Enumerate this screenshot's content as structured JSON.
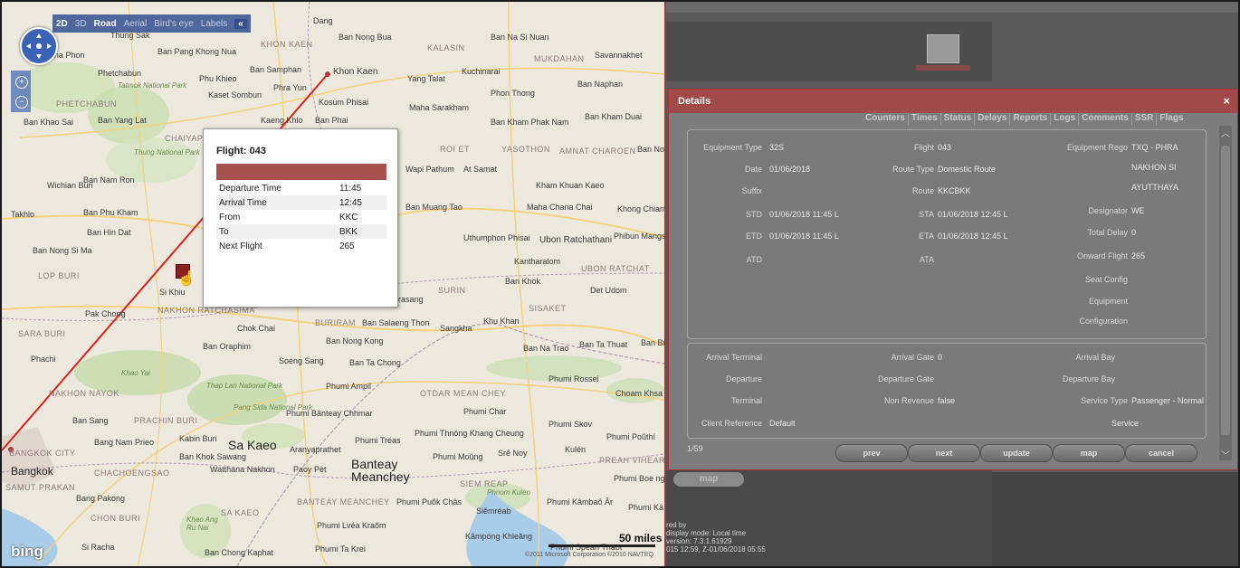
{
  "map": {
    "toolbar": {
      "mode2d": "2D",
      "mode3d": "3D",
      "road": "Road",
      "aerial": "Aerial",
      "birdseye": "Bird's eye",
      "labels": "Labels",
      "collapse": "«"
    },
    "popup": {
      "title": "Flight: 043",
      "rows": [
        {
          "label": "Departure Time",
          "value": "11:45"
        },
        {
          "label": "Arrival Time",
          "value": "12:45"
        },
        {
          "label": "From",
          "value": "KKC"
        },
        {
          "label": "To",
          "value": "BKK"
        },
        {
          "label": "Next Flight",
          "value": "265"
        }
      ]
    },
    "labels": {
      "khon_kaen": "Khon Kaen",
      "khon_kaen_region": "KHON KAEN",
      "kalasin": "KALASIN",
      "mukdahan": "MUKDAHAN",
      "savannakhet": "Savannakhet",
      "ban_nong_bua": "Ban Nong Bua",
      "ban_na_si_nuan": "Ban Na Si Nuan",
      "kuchinarai": "Kuchinarai",
      "ban_naphan": "Ban Naphan",
      "phon_thong": "Phon Thong",
      "maha_sarakham": "Maha Sarakham",
      "kosum_phisai": "Kosum Phisai",
      "ban_phai": "Ban Phai",
      "kaeng_khlo": "Kaeng Khlo",
      "ban_kham_phak_nam": "Ban Kham Phak Nam",
      "ban_kham_duai": "Ban Kham Duai",
      "yang_talat": "Yang Talat",
      "ban_samphan": "Ban Samphan",
      "phu_khieo": "Phu Khieo",
      "phra_yun": "Phra Yun",
      "kaset_sombun": "Kaset Sombun",
      "ban_pang_khong_nua": "Ban Pang Khong Nua",
      "an_tha_phon": "an Tha Phon",
      "phetchabun": "Phetchabun",
      "phetchabun_region": "PHETCHABUN",
      "tatmok": "Tatmok National Park",
      "ban_khao_sai": "Ban Khao Sai",
      "ban_yang_lat": "Ban Yang Lat",
      "chaiyaphum_region": "CHAIYAPH",
      "thung": "Thung National Park",
      "ban_nam_ron": "Ban Nam Ron",
      "wichian_buri": "Wichian Buri",
      "takhlo": "Takhlo",
      "ban_phu_kham": "Ban Phu Kham",
      "ban_hin_dat": "Ban Hin Dat",
      "ban_nong_si_ma": "Ban Nong Si Ma",
      "lop_buri": "LOP BURI",
      "si_khiu": "Si Khiu",
      "pak_chong": "Pak Chong",
      "nakhon_ratchasima": "NAKHON RATCHASIMA",
      "saraburi": "SARA BURI",
      "chok_chai": "Chok Chai",
      "ban_oraphim": "Ban Oraphim",
      "buriram": "BURIRAM",
      "ban_salaeng_thon": "Ban Salaeng Thon",
      "sangkha": "Sangkha",
      "khu_khan": "Khu Khan",
      "sisaket": "SISAKET",
      "ban_nong_kong": "Ban Nong Kong",
      "roi_et": "ROI ET",
      "yasothon": "YASOTHON",
      "amnat": "AMNAT CHAROEN",
      "ban_no": "Ban No",
      "wapi_pathum": "Wapi Pathum",
      "at_samat": "At Samat",
      "kham_khuan_kaeo": "Kham Khuan Kaeo",
      "ban_muang_tao": "Ban Muang Tao",
      "maha_chana_chai": "Maha Chana Chai",
      "khong_chiam": "Khong Chiam",
      "uthumphon": "Uthumphon Phisai",
      "ubon": "Ubon Ratchathani",
      "phibun": "Phibun Mangsahan",
      "kantharalak": "Kantharalom",
      "ubon_region": "UBON RATCHAT",
      "ban_khok": "Ban Khok",
      "surin": "SURIN",
      "det_udom": "Det Udom",
      "prasang": "rasang",
      "ban_na_trao": "Ban Na Trao",
      "ban_ta_thuat": "Ban Ta Thuat",
      "ban_bu": "Ban Bu",
      "soeng_sang": "Soeng Sang",
      "ban_ta_chong": "Ban Ta Chong",
      "phachi": "Phachi",
      "khao_yai": "Khao Yai",
      "thap_lan": "Thap Lan National Park",
      "pang_sida": "Pang Sida National Park",
      "nakhon_nayok": "NAKHON NAYOK",
      "prachin_buri": "PRACHIN BURI",
      "ban_sang": "Ban Sang",
      "phumi_ampil": "Phumi Ampil",
      "otdar_mean_chey": "OTDAR MEAN CHEY",
      "phumi_rossei": "Phumi Rossei",
      "choam_khsant": "Choam Khsa",
      "phumi_banteay": "Phumi Bânteay Chhmar",
      "phumi_char": "Phumi Char",
      "phumi_skov": "Phumi Skov",
      "phumi_thnong": "Phumi Thnóng Khang Cheung",
      "phumi_treas": "Phumi Tréas",
      "phumi_pouthi": "Phumi Poŭthí",
      "kulen": "Kulén",
      "preah_vihear": "PREAH VIHEAR",
      "sre_noy": "Srê Noy",
      "phumi_moung": "Phumi Moŭng",
      "sa_kaeo": "Sa Kaeo",
      "aranyaprathet": "Aranyaprathet",
      "kabin_buri": "Kabin Buri",
      "bang_nam_prieo": "Bang Nam Prieo",
      "ban_khok_sawang": "Ban Khok Sawang",
      "watthana_nakhon": "Watthana Nakhon",
      "poipet": "Paoy Pèt",
      "banteay_meanchey": "Banteay Meanchey",
      "siem_reap": "SIEM REAP",
      "phnom_kulen": "Phnom Kulen",
      "phumi_boeng": "Phumi Boe ng",
      "bangkok": "Bangkok",
      "bangkok_city": "BANGKOK CITY",
      "chachoengsao": "CHACHOENGSAO",
      "samut_prakan": "SAMUT PRAKAN",
      "bang_pakong": "Bang Pakong",
      "chon_buri": "CHON BURI",
      "sa_kaeo_region": "SA KAEO",
      "khao_ang_ru_nai": "Khao Ang Ru Nai",
      "banteay_meanchey_region": "BANTEAY MEANCHEY",
      "phumi_puok_chas": "Phumi Puŏk Châs",
      "siemreab": "Siĕmréab",
      "phumi_kambao": "Phumi Kâmbaô Âr",
      "phumi_putrea": "Phumi Kâ Pŭtrea",
      "phumi_lvea_kraom": "Phumi Lvéa Kraŏm",
      "kampong_khleang": "Kâmpóng Khleăng",
      "phumi_spean": "Phumi Spean Tnaot",
      "phumi_ta_krei": "Phumi Ta Krei",
      "si_racha": "Si Racha",
      "ban_chong_kaphat": "Ban Chong Kaphat",
      "hat_yai": "Thung Sak",
      "dang": "Dang",
      "phutthaisong": "Phumi"
    },
    "bing": "bing",
    "scale": "50 miles",
    "copyright": "©2011 Microsoft Corporation  ©2010 NAVTEQ"
  },
  "background_app": {
    "map_button": "map",
    "footer_line1_prefix": "red by",
    "footer_line2": "display mode: Local time",
    "footer_line3": "version: 7.3.1.61929",
    "footer_line4": "015 12:59, Z-01/06/2018 05:55"
  },
  "dialog": {
    "title": "Details",
    "close": "×",
    "tabs": [
      "Counters",
      "Times",
      "Status",
      "Delays",
      "Reports",
      "Logs",
      "Comments",
      "SSR",
      "Flags"
    ],
    "section1": {
      "equipment_type_label": "Equipment Type",
      "equipment_type": "32S",
      "date_label": "Date",
      "date": "01/06/2018",
      "suffix_label": "Suffix",
      "std_label": "STD",
      "std": "01/06/2018 11:45 L",
      "etd_label": "ETD",
      "etd": "01/06/2018 11:45 L",
      "atd_label": "ATD",
      "flight_label": "Flight",
      "flight": "043",
      "route_type_label": "Route Type",
      "route_type": "Domestic Route",
      "route_label": "Route",
      "route": "KKCBKK",
      "sta_label": "STA",
      "sta": "01/06/2018 12:45 L",
      "eta_label": "ETA",
      "eta": "01/06/2018 12:45 L",
      "ata_label": "ATA",
      "equipment_rego_label": "Equipment Rego",
      "equipment_rego": "TXQ - PHRA",
      "equipment_rego_line2": "NAKHON SI",
      "equipment_rego_line3": "AYUTTHAYA",
      "designator_label": "Designator",
      "designator": "WE",
      "total_delay_label": "Total Delay",
      "total_delay": "0",
      "onward_flight_label": "Onward Flight",
      "onward_flight": "265",
      "seat_config_label": "Seat Config",
      "equipment_config_label1": "Equipment",
      "equipment_config_label2": "Configuration"
    },
    "section2": {
      "arrival_terminal_label": "Arrival Terminal",
      "departure_terminal_label1": "Departure",
      "departure_terminal_label2": "Terminal",
      "client_reference_label": "Client Reference",
      "client_reference": "Default",
      "arrival_gate_label": "Arrival Gate",
      "arrival_gate": "0",
      "departure_gate_label": "Departure Gate",
      "non_revenue_label": "Non Revenue",
      "non_revenue": "false",
      "arrival_bay_label": "Arrival Bay",
      "departure_bay_label": "Departure Bay",
      "service_type_label": "Service Type",
      "service_type": "Passenger - Normal",
      "service_type_line2": "Service"
    },
    "counter": "1/59",
    "buttons": {
      "prev": "prev",
      "next": "next",
      "update": "update",
      "map": "map",
      "cancel": "cancel"
    }
  },
  "colors": {
    "accent_red": "#a14a49",
    "route_line": "#e0201a",
    "dialog_bg": "#7d7d7d",
    "map_toolbar": "#2f4f96"
  }
}
